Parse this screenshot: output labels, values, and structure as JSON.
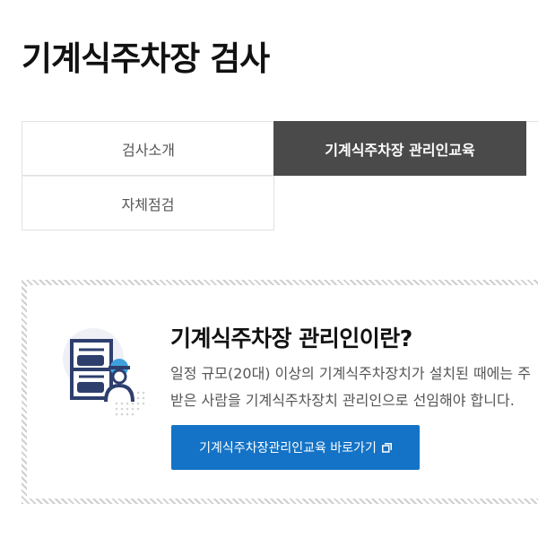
{
  "page_title": "기계식주차장 검사",
  "tabs": [
    {
      "label": "검사소개",
      "active": false
    },
    {
      "label": "기계식주차장 관리인교육",
      "active": true
    },
    {
      "label": "자체점검",
      "active": false
    }
  ],
  "info": {
    "heading": "기계식주차장 관리인이란?",
    "description_lines": [
      "일정 규모(20대) 이상의 기계식주차장치가 설치된 때에는 주",
      "받은 사람을 기계식주차장치 관리인으로 선임해야 합니다."
    ],
    "button_label": "기계식주차장관리인교육 바로가기",
    "button_icon": "external-link-icon",
    "illustration_icon": "parking-attendant-illustration"
  },
  "colors": {
    "active_tab_bg": "#4a4a4a",
    "button_bg": "#1473c6",
    "illustration_navy": "#2e3f6e",
    "illustration_blue": "#3da0dc"
  }
}
